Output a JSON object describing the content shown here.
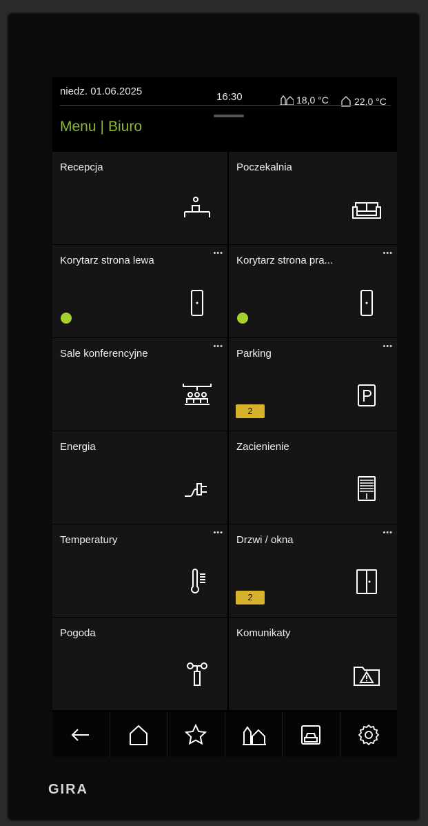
{
  "status": {
    "date": "niedz. 01.06.2025",
    "time": "16:30",
    "outdoor_temp": "18,0 °C",
    "indoor_temp": "22,0 °C"
  },
  "breadcrumb": {
    "root": "Menu",
    "current": "Biuro"
  },
  "tiles": [
    {
      "label": "Recepcja",
      "icon": "reception-desk-icon"
    },
    {
      "label": "Poczekalnia",
      "icon": "sofa-icon"
    },
    {
      "label": "Korytarz strona lewa",
      "icon": "door-icon",
      "more": "•••",
      "status": "active"
    },
    {
      "label": "Korytarz strona pra...",
      "icon": "door-icon",
      "more": "•••",
      "status": "active"
    },
    {
      "label": "Sale konferencyjne",
      "icon": "conference-icon",
      "more": "•••"
    },
    {
      "label": "Parking",
      "icon": "parking-icon",
      "more": "•••",
      "badge": "2"
    },
    {
      "label": "Energia",
      "icon": "plug-icon"
    },
    {
      "label": "Zacienienie",
      "icon": "blinds-icon"
    },
    {
      "label": "Temperatury",
      "icon": "thermometer-icon",
      "more": "•••"
    },
    {
      "label": "Drzwi / okna",
      "icon": "window-icon",
      "more": "•••",
      "badge": "2"
    },
    {
      "label": "Pogoda",
      "icon": "weather-station-icon"
    },
    {
      "label": "Komunikaty",
      "icon": "warning-folder-icon"
    }
  ],
  "navbar": [
    "back-arrow-icon",
    "home-icon",
    "star-icon",
    "outdoor-home-icon",
    "garage-icon",
    "settings-icon"
  ],
  "brand": "GIRA",
  "colors": {
    "accent": "#8ab82e",
    "status_dot": "#a6d12c",
    "badge": "#d6b32a"
  }
}
